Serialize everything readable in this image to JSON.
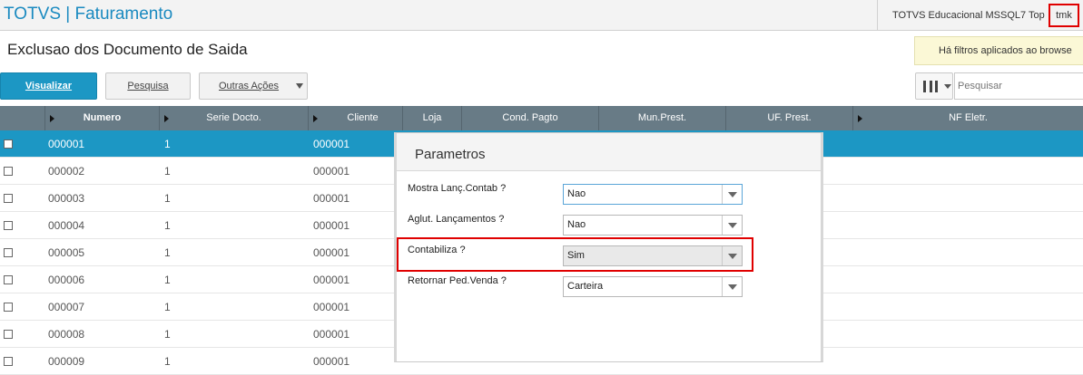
{
  "topbar": {
    "brand": "TOTVS",
    "separator": "|",
    "module": "Faturamento",
    "environment": "TOTVS Educacional MSSQL7 Top",
    "user": "tmk"
  },
  "page": {
    "title": "Exclusao dos Documento de Saida",
    "filter_notice": "Há filtros aplicados ao browse"
  },
  "toolbar": {
    "visualizar_label": "Visualizar",
    "pesquisa_label": "Pesquisa",
    "outras_acoes_label": "Outras Ações",
    "search_placeholder": "Pesquisar"
  },
  "grid": {
    "columns": [
      "Numero",
      "Serie Docto.",
      "Cliente",
      "Loja",
      "Cond. Pagto",
      "Mun.Prest.",
      "UF. Prest.",
      "NF Eletr."
    ],
    "rows": [
      {
        "numero": "000001",
        "serie": "1",
        "cliente": "000001"
      },
      {
        "numero": "000002",
        "serie": "1",
        "cliente": "000001"
      },
      {
        "numero": "000003",
        "serie": "1",
        "cliente": "000001"
      },
      {
        "numero": "000004",
        "serie": "1",
        "cliente": "000001"
      },
      {
        "numero": "000005",
        "serie": "1",
        "cliente": "000001"
      },
      {
        "numero": "000006",
        "serie": "1",
        "cliente": "000001"
      },
      {
        "numero": "000007",
        "serie": "1",
        "cliente": "000001"
      },
      {
        "numero": "000008",
        "serie": "1",
        "cliente": "000001"
      },
      {
        "numero": "000009",
        "serie": "1",
        "cliente": "000001"
      }
    ]
  },
  "dialog": {
    "title": "Parametros",
    "params": [
      {
        "label": "Mostra Lanç.Contab ?",
        "value": "Nao"
      },
      {
        "label": "Aglut. Lançamentos ?",
        "value": "Nao"
      },
      {
        "label": "Contabiliza ?",
        "value": "Sim"
      },
      {
        "label": "Retornar Ped.Venda ?",
        "value": "Carteira"
      }
    ]
  },
  "colors": {
    "brand_blue": "#1a8ac0",
    "selected_row": "#1c97c4",
    "grid_header": "#687b86",
    "highlight_red": "#e00000",
    "filter_notice_bg": "#fbf8d6"
  },
  "icons": {
    "view_toggle": "columns-icon",
    "dropdown": "chevron-down-icon",
    "sort": "triangle-right-icon"
  }
}
